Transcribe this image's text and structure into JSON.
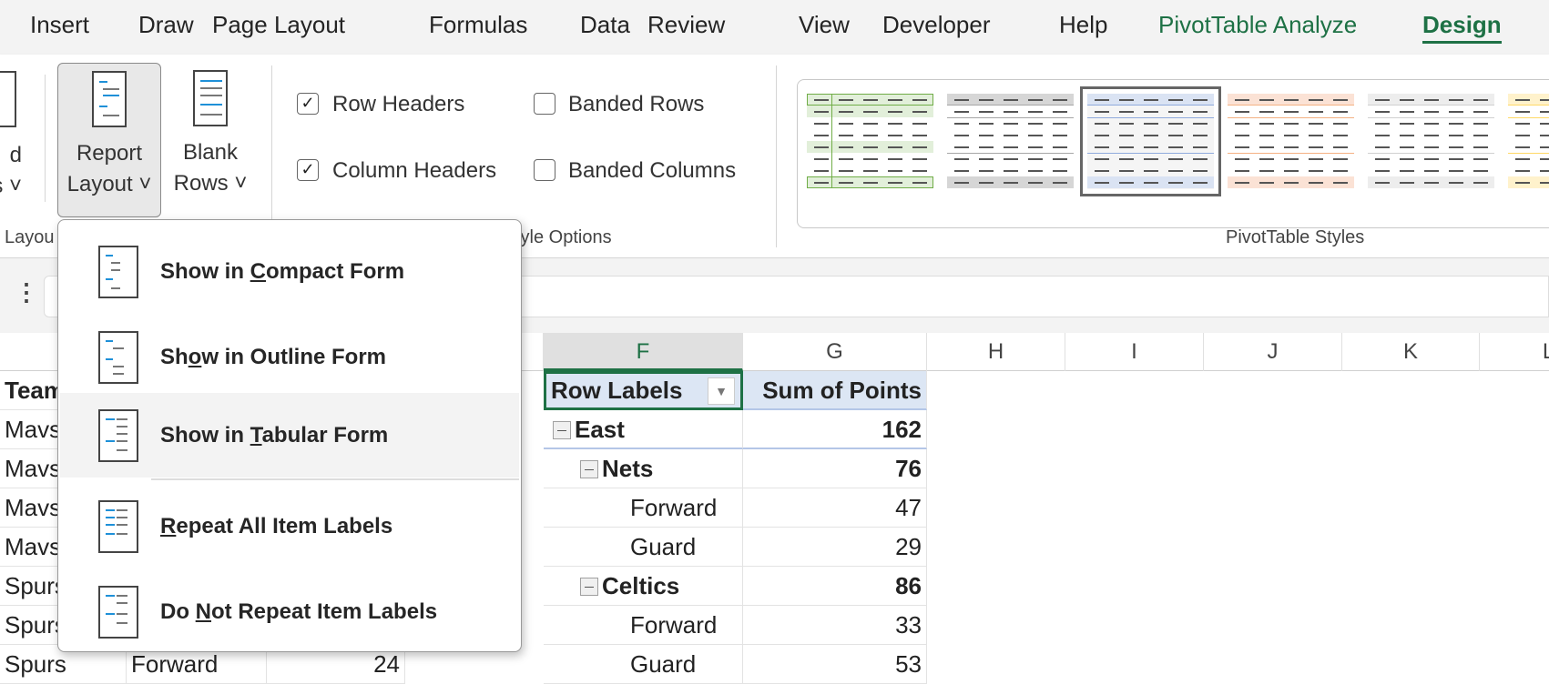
{
  "menu_tabs": [
    {
      "label": "Insert"
    },
    {
      "label": "Draw"
    },
    {
      "label": "Page Layout"
    },
    {
      "label": "Formulas"
    },
    {
      "label": "Data"
    },
    {
      "label": "Review"
    },
    {
      "label": "View"
    },
    {
      "label": "Developer"
    },
    {
      "label": "Help"
    },
    {
      "label": "PivotTable Analyze"
    },
    {
      "label": "Design",
      "active": true
    }
  ],
  "ribbon": {
    "partial_button": {
      "line1": "d",
      "line2": "s ˅"
    },
    "report_layout": {
      "line1": "Report",
      "line2": "Layout ˅"
    },
    "blank_rows": {
      "line1": "Blank",
      "line2": "Rows ˅"
    },
    "layout_group_label": "Layou",
    "style_options": {
      "row_headers": {
        "label": "Row Headers",
        "checked": true
      },
      "column_headers": {
        "label": "Column Headers",
        "checked": true
      },
      "banded_rows": {
        "label": "Banded Rows",
        "checked": false
      },
      "banded_columns": {
        "label": "Banded Columns",
        "checked": false
      },
      "group_label": "tyle Options"
    },
    "styles_group_label": "PivotTable Styles",
    "styles": [
      {
        "name": "light-green",
        "fill": "#e2efda",
        "line": "#70ad47"
      },
      {
        "name": "medium-gray",
        "fill": "#d6d6d6",
        "line": "#a6a6a6"
      },
      {
        "name": "light-blue",
        "fill": "#dae3f3",
        "line": "#8faadc",
        "selected": true
      },
      {
        "name": "light-orange",
        "fill": "#fbe2d5",
        "line": "#f4b183"
      },
      {
        "name": "light-gray",
        "fill": "#ededed",
        "line": "#d0d0d0"
      },
      {
        "name": "light-yellow",
        "fill": "#fff2cc",
        "line": "#ffd966"
      }
    ]
  },
  "formula_bar": {
    "more_icon": "⋮"
  },
  "columns": [
    "F",
    "G",
    "H",
    "I",
    "J",
    "K",
    "L"
  ],
  "left_table": {
    "header": "Team",
    "rows": [
      "Mavs",
      "Mavs",
      "Mavs",
      "Mavs",
      "Spurs",
      "Spurs",
      "Spurs"
    ],
    "last_row": {
      "position": "Forward",
      "points": "24"
    }
  },
  "pivot": {
    "header_label": "Row Labels",
    "header_value": "Sum of Points",
    "rows": [
      {
        "label": "East",
        "value": "162",
        "level": 0,
        "bold": true
      },
      {
        "label": "Nets",
        "value": "76",
        "level": 1,
        "bold": true
      },
      {
        "label": "Forward",
        "value": "47",
        "level": 2
      },
      {
        "label": "Guard",
        "value": "29",
        "level": 2
      },
      {
        "label": "Celtics",
        "value": "86",
        "level": 1,
        "bold": true
      },
      {
        "label": "Forward",
        "value": "33",
        "level": 2
      },
      {
        "label": "Guard",
        "value": "53",
        "level": 2
      }
    ]
  },
  "report_layout_menu": [
    {
      "pre": "Show in ",
      "key": "C",
      "post": "ompact Form"
    },
    {
      "pre": "Sh",
      "key": "o",
      "post": "w in Outline Form"
    },
    {
      "pre": "Show in ",
      "key": "T",
      "post": "abular Form",
      "highlighted": true
    },
    {
      "pre": "",
      "key": "R",
      "post": "epeat All Item Labels"
    },
    {
      "pre": "Do ",
      "key": "N",
      "post": "ot Repeat Item Labels"
    }
  ]
}
